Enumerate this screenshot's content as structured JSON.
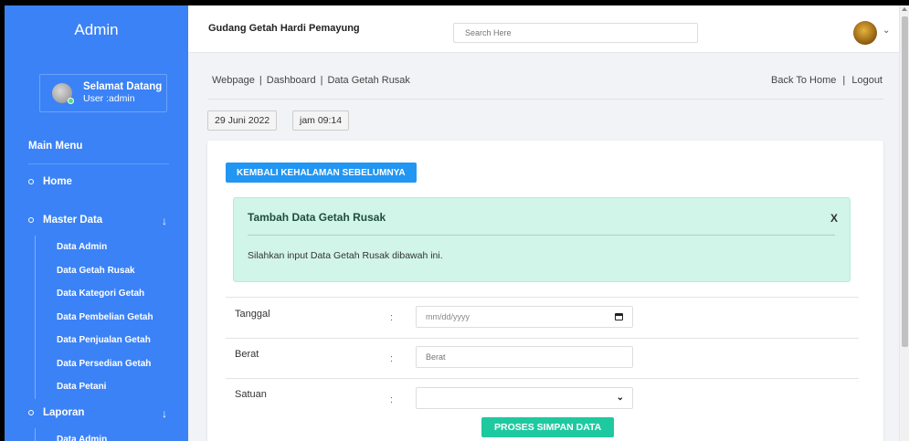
{
  "sidebar": {
    "brand": "Admin",
    "user": {
      "greeting": "Selamat Datang",
      "role": "User :admin"
    },
    "menu_title": "Main Menu",
    "home": "Home",
    "master_data": {
      "label": "Master Data",
      "items": [
        "Data Admin",
        "Data Getah Rusak",
        "Data Kategori Getah",
        "Data Pembelian Getah",
        "Data Penjualan Getah",
        "Data Persedian Getah",
        "Data Petani"
      ]
    },
    "laporan": {
      "label": "Laporan",
      "items": [
        "Data Admin"
      ]
    }
  },
  "topbar": {
    "site_title": "Gudang Getah Hardi Pemayung",
    "search_placeholder": "Search Here"
  },
  "breadcrumb": {
    "items": [
      "Webpage",
      "Dashboard",
      "Data Getah Rusak"
    ],
    "separator": "|"
  },
  "top_links": {
    "back": "Back To Home",
    "separator": "|",
    "logout": "Logout"
  },
  "date_chip": "29 Juni 2022",
  "time_chip": "jam 09:14",
  "content": {
    "back_button": "KEMBALI KEHALAMAN SEBELUMNYA",
    "alert": {
      "title": "Tambah Data Getah Rusak",
      "close": "X",
      "message": "Silahkan input Data Getah Rusak dibawah ini."
    },
    "form": {
      "tanggal": {
        "label": "Tanggal",
        "colon": ":",
        "placeholder": "mm/dd/yyyy"
      },
      "berat": {
        "label": "Berat",
        "colon": ":",
        "placeholder": "Berat"
      },
      "satuan": {
        "label": "Satuan",
        "colon": ":",
        "value": ""
      }
    },
    "save_button": "PROSES SIMPAN DATA"
  },
  "colors": {
    "sidebar": "#3b82f6",
    "primary_button": "#2196f3",
    "success_button": "#1fc9a0",
    "alert_bg": "#d1f5e8"
  }
}
